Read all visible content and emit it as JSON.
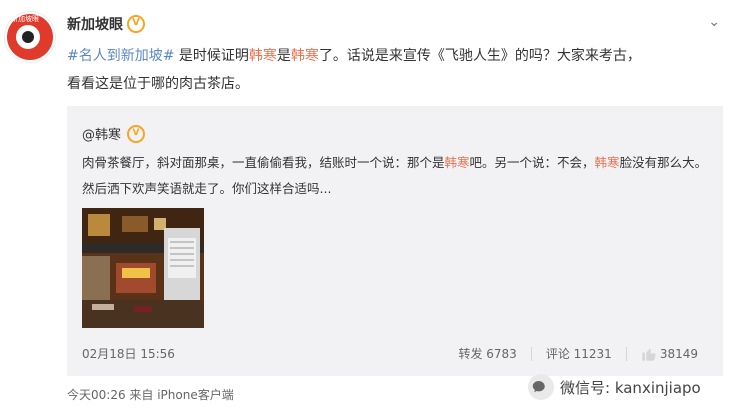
{
  "author": {
    "name": "新加坡眼",
    "avatar_tag": "新加坡眼",
    "verified": "V"
  },
  "post": {
    "hashtag": "#名人到新加坡#",
    "t1": " 是时候证明",
    "n1": "韩寒",
    "t2": "是",
    "n2": "韩寒",
    "t3": "了。话说是来宣传《飞驰人生》的吗？大家来考古，",
    "t4": "看看这是位于哪的肉古茶店。"
  },
  "quote": {
    "user": "@韩寒",
    "badge": "V",
    "p1": "肉骨茶餐厅，斜对面那桌，一直偷偷看我，结账时一个说：那个是",
    "n1": "韩寒",
    "p2": "吧。另一个说：不会，",
    "n2": "韩寒",
    "p3": "脸没有那么大。然后洒下欢声笑语就走了。你们这样合适吗..."
  },
  "meta": {
    "date": "02月18日 15:56",
    "reposts_label": "转发 6783",
    "comments_label": "评论 11231",
    "likes": "38149"
  },
  "footer": {
    "time_source": "今天00:26 来自 iPhone客户端",
    "wechat_label": "微信号: kanxinjiapo"
  }
}
